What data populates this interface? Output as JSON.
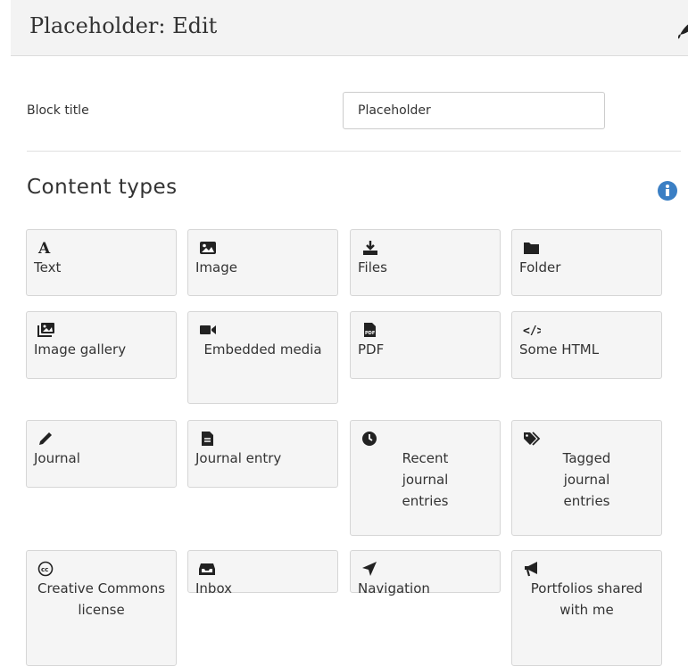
{
  "header": {
    "title": "Placeholder: Edit",
    "edit_icon": "feather-pen-icon"
  },
  "block_title": {
    "label": "Block title",
    "value": "Placeholder"
  },
  "content_types": {
    "title": "Content types",
    "info_icon": "info-circle-icon",
    "items": [
      {
        "label": "Text",
        "icon": "text-icon"
      },
      {
        "label": "Image",
        "icon": "image-icon"
      },
      {
        "label": "Files",
        "icon": "download-icon"
      },
      {
        "label": "Folder",
        "icon": "folder-icon"
      },
      {
        "label": "Image gallery",
        "icon": "image-gallery-icon"
      },
      {
        "label": "Embedded media",
        "icon": "video-camera-icon"
      },
      {
        "label": "PDF",
        "icon": "pdf-icon"
      },
      {
        "label": "Some HTML",
        "icon": "code-icon"
      },
      {
        "label": "Journal",
        "icon": "pencil-icon"
      },
      {
        "label": "Journal entry",
        "icon": "document-icon"
      },
      {
        "label": "Recent journal entries",
        "icon": "clock-icon"
      },
      {
        "label": "Tagged journal entries",
        "icon": "tags-icon"
      },
      {
        "label": "Creative Commons license",
        "icon": "creative-commons-icon"
      },
      {
        "label": "Inbox",
        "icon": "inbox-icon"
      },
      {
        "label": "Navigation",
        "icon": "location-arrow-icon"
      },
      {
        "label": "Portfolios shared with me",
        "icon": "bullhorn-icon"
      }
    ]
  },
  "colors": {
    "header_bg": "#f3f3f3",
    "tile_bg": "#f5f5f5",
    "info_blue": "#3b7fc4"
  }
}
